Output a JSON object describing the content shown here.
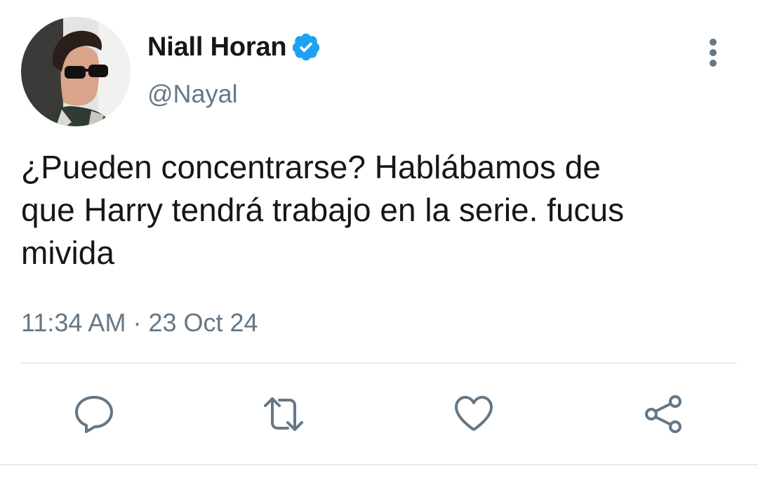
{
  "author": {
    "display_name": "Niall Horan",
    "handle": "@Nayal",
    "verified": true,
    "avatar_icon": "profile-photo"
  },
  "tweet": {
    "text": "¿Pueden concentrarse? Hablábamos de\nque Harry tendrá trabajo en la serie. fucus\nmivida",
    "time": "11:34 AM",
    "separator": "·",
    "date": "23 Oct 24"
  },
  "actions": [
    {
      "name": "reply",
      "icon": "speech-bubble-icon"
    },
    {
      "name": "retweet",
      "icon": "retweet-arrows-icon"
    },
    {
      "name": "like",
      "icon": "heart-icon"
    },
    {
      "name": "share",
      "icon": "share-icon"
    }
  ],
  "colors": {
    "verified_blue": "#1da1f2",
    "secondary_text": "#657786",
    "primary_text": "#14171a",
    "action_icon": "#657786",
    "divider": "#e6ecf0"
  }
}
